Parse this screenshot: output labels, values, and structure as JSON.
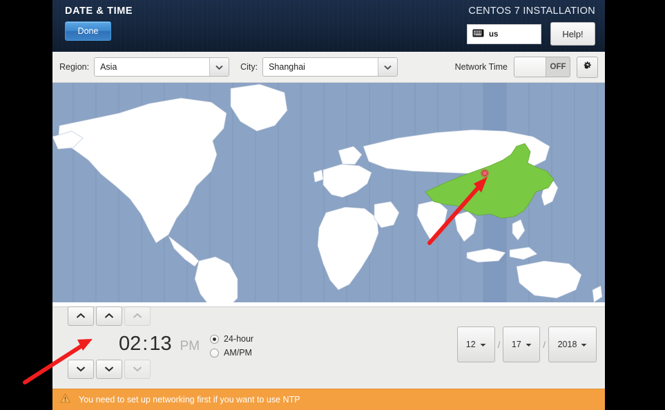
{
  "header": {
    "title": "DATE & TIME",
    "done_label": "Done",
    "install_title": "CENTOS 7 INSTALLATION",
    "keyboard_layout": "us",
    "keyboard_icon": "keyboard-icon",
    "help_label": "Help!"
  },
  "selector": {
    "region_label": "Region:",
    "region_value": "Asia",
    "city_label": "City:",
    "city_value": "Shanghai",
    "network_time_label": "Network Time",
    "network_time_state": "OFF",
    "gear_icon": "gear-icon"
  },
  "map": {
    "highlighted_country": "China",
    "marker_city": "Shanghai",
    "ocean_color": "#8ba3c4",
    "land_color": "#ffffff",
    "highlight_color": "#7ac943",
    "marker_color": "#e8515a"
  },
  "time": {
    "hours": "02",
    "colon": ":",
    "minutes": "13",
    "ampm": "PM",
    "up_icon": "chevron-up-icon",
    "down_icon": "chevron-down-icon",
    "format_options": [
      {
        "label": "24-hour",
        "selected": true
      },
      {
        "label": "AM/PM",
        "selected": false
      }
    ]
  },
  "date": {
    "month": "12",
    "day": "17",
    "year": "2018",
    "separator": "/",
    "dropdown_icon": "chevron-down-icon"
  },
  "warning": {
    "icon": "warning-triangle-icon",
    "text": "You need to set up networking first if you want to use NTP",
    "background_color": "#f4a041"
  }
}
